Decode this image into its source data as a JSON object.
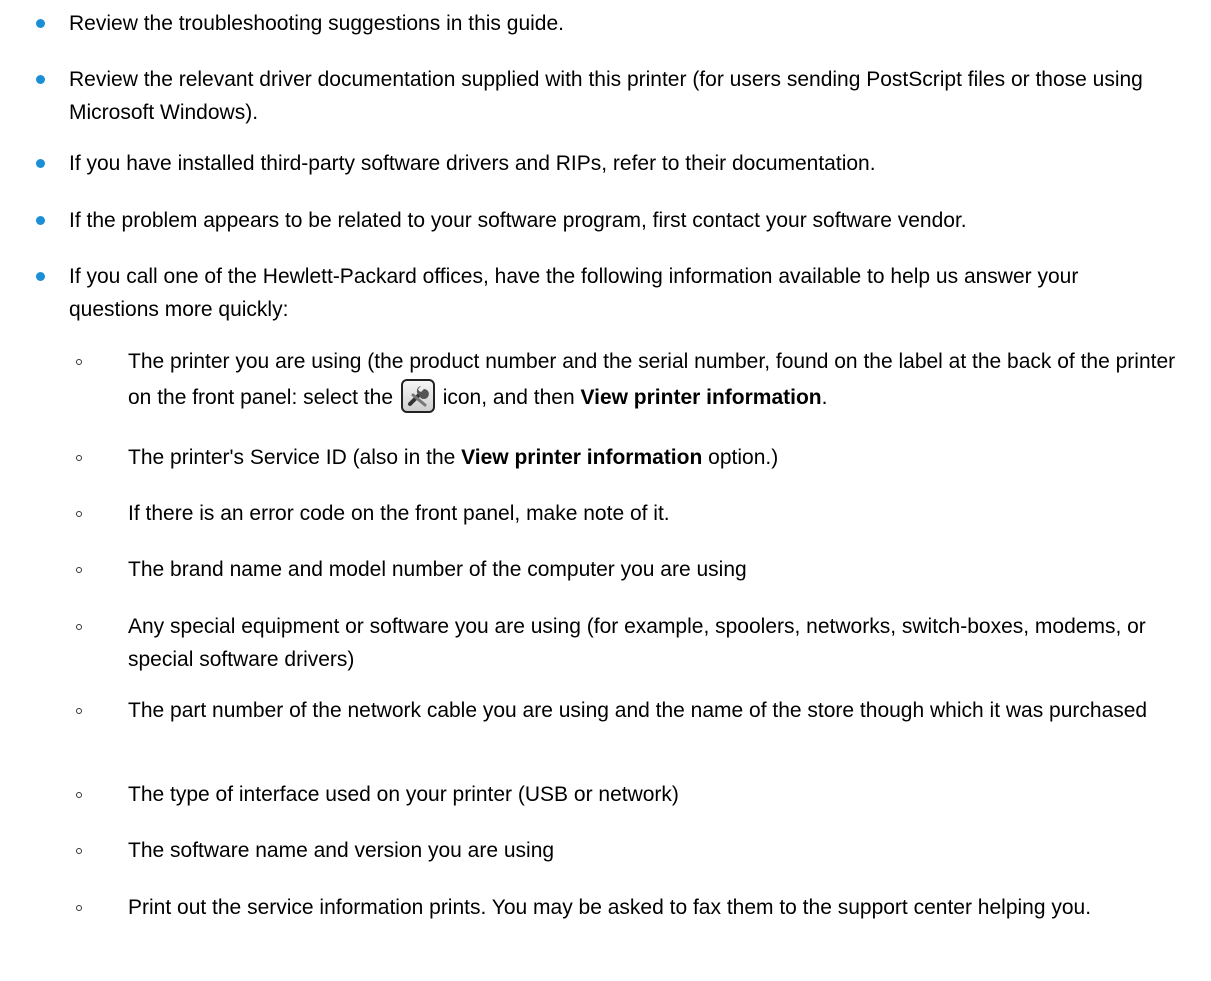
{
  "items": [
    {
      "text": "Review the troubleshooting suggestions in this guide."
    },
    {
      "text": "Review the relevant driver documentation supplied with this printer (for users sending PostScript files or those using Microsoft Windows)."
    },
    {
      "text": "If you have installed third-party software drivers and RIPs, refer to their documentation."
    },
    {
      "text": "If the problem appears to be related to your software program, first contact your software vendor."
    },
    {
      "text": "If you call one of the Hewlett-Packard offices, have the following information available to help us answer your questions more quickly:"
    }
  ],
  "subitems": {
    "s1_part1": "The printer you are using (the product number and the serial number, found on the label at the back of the printer on the front panel: select the",
    "s1_part2": "icon, and then",
    "s1_bold": "View printer information",
    "s1_end": ".",
    "s1_icon": "wrench-icon",
    "s2_part1": "The printer's Service ID (also in the",
    "s2_bold": "View printer information",
    "s2_end": "option.)",
    "s3": "If there is an error code on the front panel, make note of it.",
    "s4": "The brand name and model number of the computer you are using",
    "s5": "Any special equipment or software you are using (for example, spoolers, networks, switch-boxes, modems, or special software drivers)",
    "s6": "The part number of the network cable you are using and the name of the store though which it was purchased",
    "s7": "The type of interface used on your printer (USB or network)",
    "s8": "The software name and version you are using",
    "s9": "Print out the service information prints. You may be asked to fax them to the support center helping you."
  },
  "colors": {
    "bullet": "#1a8fd6",
    "text": "#000000"
  }
}
